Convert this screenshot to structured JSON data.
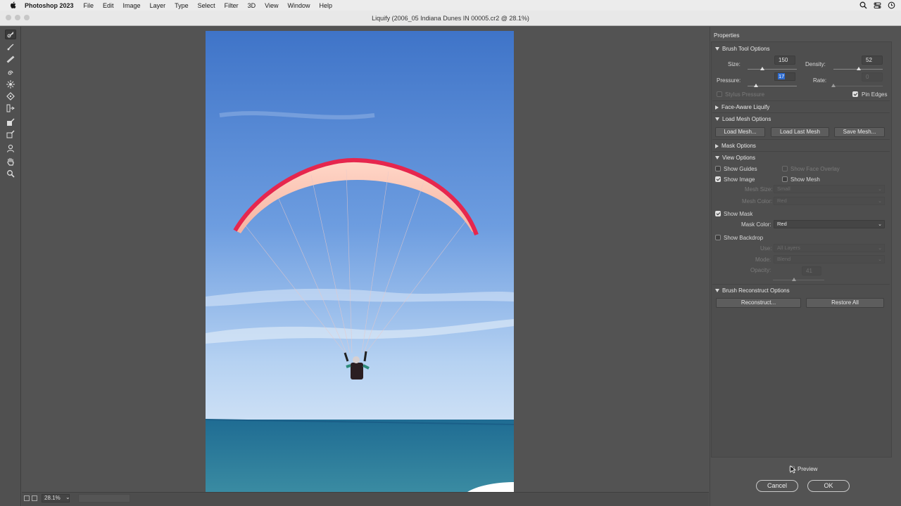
{
  "menubar": {
    "app": "Photoshop 2023",
    "items": [
      "File",
      "Edit",
      "Image",
      "Layer",
      "Type",
      "Select",
      "Filter",
      "3D",
      "View",
      "Window",
      "Help"
    ]
  },
  "window": {
    "title": "Liquify (2006_05 Indiana Dunes IN 00005.cr2 @ 28.1%)"
  },
  "tools": [
    "forward-warp-tool",
    "reconstruct-tool",
    "smooth-tool",
    "twirl-clockwise-tool",
    "pucker-tool",
    "bloat-tool",
    "push-left-tool",
    "freeze-mask-tool",
    "thaw-mask-tool",
    "face-tool",
    "hand-tool",
    "zoom-tool"
  ],
  "status": {
    "zoom": "28.1%"
  },
  "panel": {
    "title": "Properties",
    "brush": {
      "header": "Brush Tool Options",
      "size_label": "Size:",
      "size": "150",
      "size_level": 0.3,
      "density_label": "Density:",
      "density": "52",
      "density_level": 0.52,
      "pressure_label": "Pressure:",
      "pressure": "17",
      "pressure_level": 0.17,
      "rate_label": "Rate:",
      "rate": "0",
      "rate_level": 0.0,
      "stylus_label": "Stylus Pressure",
      "pin_edges_label": "Pin Edges"
    },
    "face_aware": {
      "header": "Face-Aware Liquify"
    },
    "mesh": {
      "header": "Load Mesh Options",
      "load": "Load Mesh...",
      "load_last": "Load Last Mesh",
      "save": "Save Mesh..."
    },
    "mask": {
      "header": "Mask Options"
    },
    "view": {
      "header": "View Options",
      "show_guides": "Show Guides",
      "show_face_overlay": "Show Face Overlay",
      "show_image": "Show Image",
      "show_mesh": "Show Mesh",
      "mesh_size_label": "Mesh Size:",
      "mesh_size": "Small",
      "mesh_color_label": "Mesh Color:",
      "mesh_color": "Red",
      "show_mask": "Show Mask",
      "mask_color_label": "Mask Color:",
      "mask_color": "Red",
      "show_backdrop": "Show Backdrop",
      "use_label": "Use:",
      "use": "All Layers",
      "mode_label": "Mode:",
      "mode": "Blend",
      "opacity_label": "Opacity:",
      "opacity": "41",
      "opacity_level": 0.41
    },
    "reconstruct": {
      "header": "Brush Reconstruct Options",
      "reconstruct": "Reconstruct...",
      "restore_all": "Restore All"
    },
    "preview_label": "Preview",
    "cancel": "Cancel",
    "ok": "OK"
  }
}
